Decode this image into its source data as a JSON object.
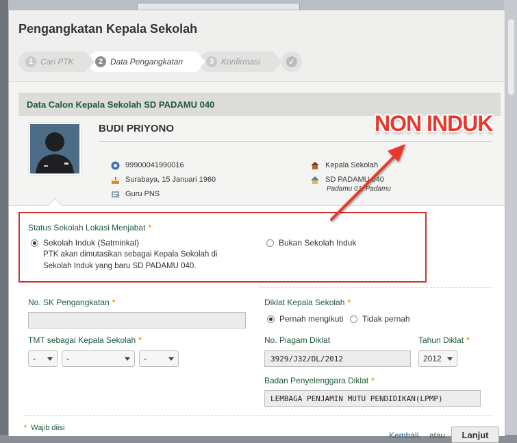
{
  "dialog": {
    "title": "Pengangkatan Kepala Sekolah"
  },
  "wizard": {
    "steps": [
      {
        "num": "1",
        "label": "Cari PTK"
      },
      {
        "num": "2",
        "label": "Data Pengangkatan"
      },
      {
        "num": "3",
        "label": "Konfirmasi"
      },
      {
        "num": "✓",
        "label": ""
      }
    ]
  },
  "candidate": {
    "panel_title": "Data Calon Kepala Sekolah SD PADAMU 040",
    "name": "BUDI PRIYONO",
    "id": "99900041990016",
    "birth": "Surabaya, 15 Januari 1960",
    "type": "Guru PNS",
    "role": "Kepala Sekolah",
    "school": "SD PADAMU 040",
    "school_sub": "Padamu 01, Padamu"
  },
  "annotation": {
    "text": "NON INDUK",
    "color": "#e8382d"
  },
  "status": {
    "label": "Status Sekolah Lokasi Menjabat",
    "required": "*",
    "option1": "Sekolah Induk (Satminkal)",
    "option1_help1": "PTK akan dimutasikan sebagai Kepala Sekolah di",
    "option1_help2": "Sekolah Induk yang baru SD PADAMU 040.",
    "option2": "Bukan Sekolah Induk",
    "selected": "option1"
  },
  "form": {
    "sk_label": "No. SK Pengangkatan",
    "sk_value": "",
    "tmt_label": "TMT sebagai Kepala Sekolah",
    "tmt_day": "-",
    "tmt_month": "-",
    "tmt_year": "-",
    "diklat_label": "Diklat Kepala Sekolah",
    "diklat_opt1": "Pernah mengikuti",
    "diklat_opt2": "Tidak pernah",
    "piagam_label": "No. Piagam Diklat",
    "piagam_value": "3929/J32/DL/2012",
    "tahun_label": "Tahun Diklat",
    "tahun_value": "2012",
    "badan_label": "Badan Penyelenggara Diklat",
    "badan_value": "LEMBAGA PENJAMIN MUTU PENDIDIKAN(LPMP)",
    "required": "*"
  },
  "footer": {
    "note_star": "*",
    "note": "Wajib diisi",
    "back": "Kembali,",
    "or": "atau",
    "next": "Lanjut"
  }
}
